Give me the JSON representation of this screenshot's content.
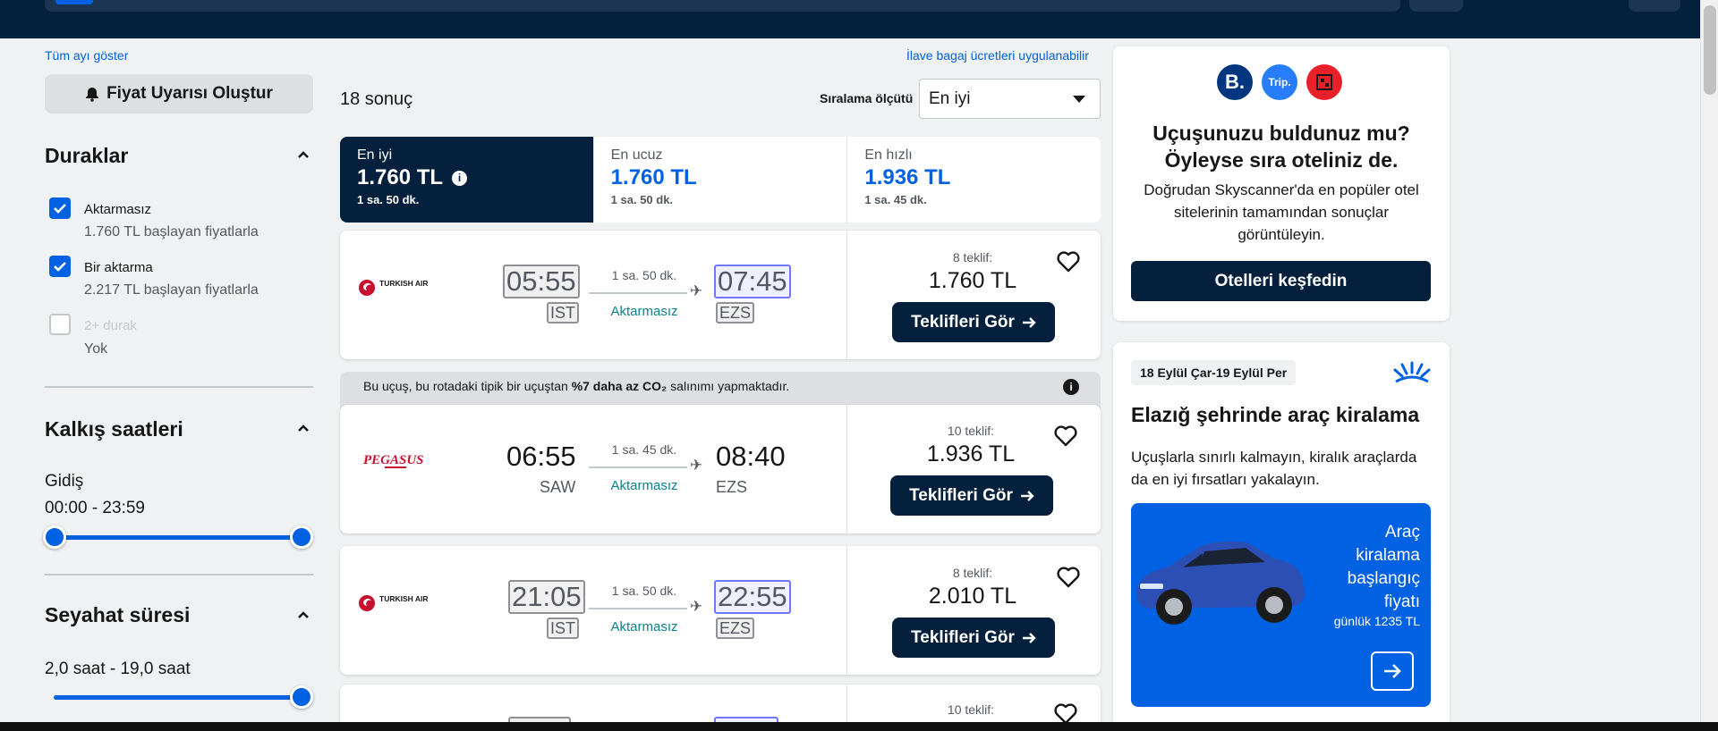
{
  "left": {
    "show_month_link": "Tüm ayı göster",
    "price_alert_button": "Fiyat Uyarısı Oluştur",
    "stops": {
      "heading": "Duraklar",
      "options": [
        {
          "label": "Aktarmasız",
          "sub": "1.760 TL başlayan fiyatlarla",
          "checked": true
        },
        {
          "label": "Bir aktarma",
          "sub": "2.217 TL başlayan fiyatlarla",
          "checked": true
        },
        {
          "label": "2+ durak",
          "sub": "Yok",
          "checked": false
        }
      ]
    },
    "departure": {
      "heading": "Kalkış saatleri",
      "direction": "Gidiş",
      "range": "00:00 - 23:59",
      "range_fraction": [
        0,
        1
      ]
    },
    "duration": {
      "heading": "Seyahat süresi",
      "range": "2,0 saat - 19,0 saat",
      "max_fraction": 1
    }
  },
  "results": {
    "baggage_link": "İlave bagaj ücretleri uygulanabilir",
    "count": "18 sonuç",
    "sort_label": "Sıralama ölçütü",
    "sort_value": "En iyi",
    "tabs": [
      {
        "name": "En iyi",
        "price": "1.760 TL",
        "duration": "1 sa. 50 dk.",
        "active": true
      },
      {
        "name": "En ucuz",
        "price": "1.760 TL",
        "duration": "1 sa. 50 dk.",
        "active": false
      },
      {
        "name": "En hızlı",
        "price": "1.936 TL",
        "duration": "1 sa. 45 dk.",
        "active": false
      }
    ],
    "eco_banner": {
      "before": "Bu uçuş, bu rotadaki tipik bir uçuştan ",
      "bold": "%7 daha az CO₂",
      "after": " salınımı yapmaktadır."
    },
    "flights": [
      {
        "airline": "TURKISH AIRLINES",
        "dep_time": "05:55",
        "dep_code": "IST",
        "arr_time": "07:45",
        "arr_code": "EZS",
        "duration": "1 sa. 50 dk.",
        "stops": "Aktarmasız",
        "offers": "8 teklif:",
        "price": "1.760 TL",
        "button": "Teklifleri Gör"
      },
      {
        "airline": "PEGASUS",
        "dep_time": "06:55",
        "dep_code": "SAW",
        "arr_time": "08:40",
        "arr_code": "EZS",
        "duration": "1 sa. 45 dk.",
        "stops": "Aktarmasız",
        "offers": "10 teklif:",
        "price": "1.936 TL",
        "button": "Teklifleri Gör"
      },
      {
        "airline": "TURKISH AIRLINES",
        "dep_time": "21:05",
        "dep_code": "IST",
        "arr_time": "22:55",
        "arr_code": "EZS",
        "duration": "1 sa. 50 dk.",
        "stops": "Aktarmasız",
        "offers": "8 teklif:",
        "price": "2.010 TL",
        "button": "Teklifleri Gör"
      },
      {
        "offers": "10 teklif:"
      }
    ]
  },
  "hotel": {
    "partners": [
      "B.",
      "Trip."
    ],
    "title_line1": "Uçuşunuzu buldunuz mu?",
    "title_line2": "Öyleyse sıra oteliniz de.",
    "description": "Doğrudan Skyscanner'da en popüler otel sitelerinin tamamından sonuçlar görüntüleyin.",
    "button": "Otelleri keşfedin"
  },
  "car": {
    "dates": "18 Eylül Çar-19 Eylül Per",
    "title": "Elazığ şehrinde araç kiralama",
    "description": "Uçuşlarla sınırlı kalmayın, kiralık araçlarda da en iyi fırsatları yakalayın.",
    "promo_title": "Araç kiralama başlangıç fiyatı",
    "promo_price": "günlük 1235 TL"
  },
  "colors": {
    "navy": "#05203c",
    "blue": "#0062e3",
    "teal": "#0c838a"
  }
}
